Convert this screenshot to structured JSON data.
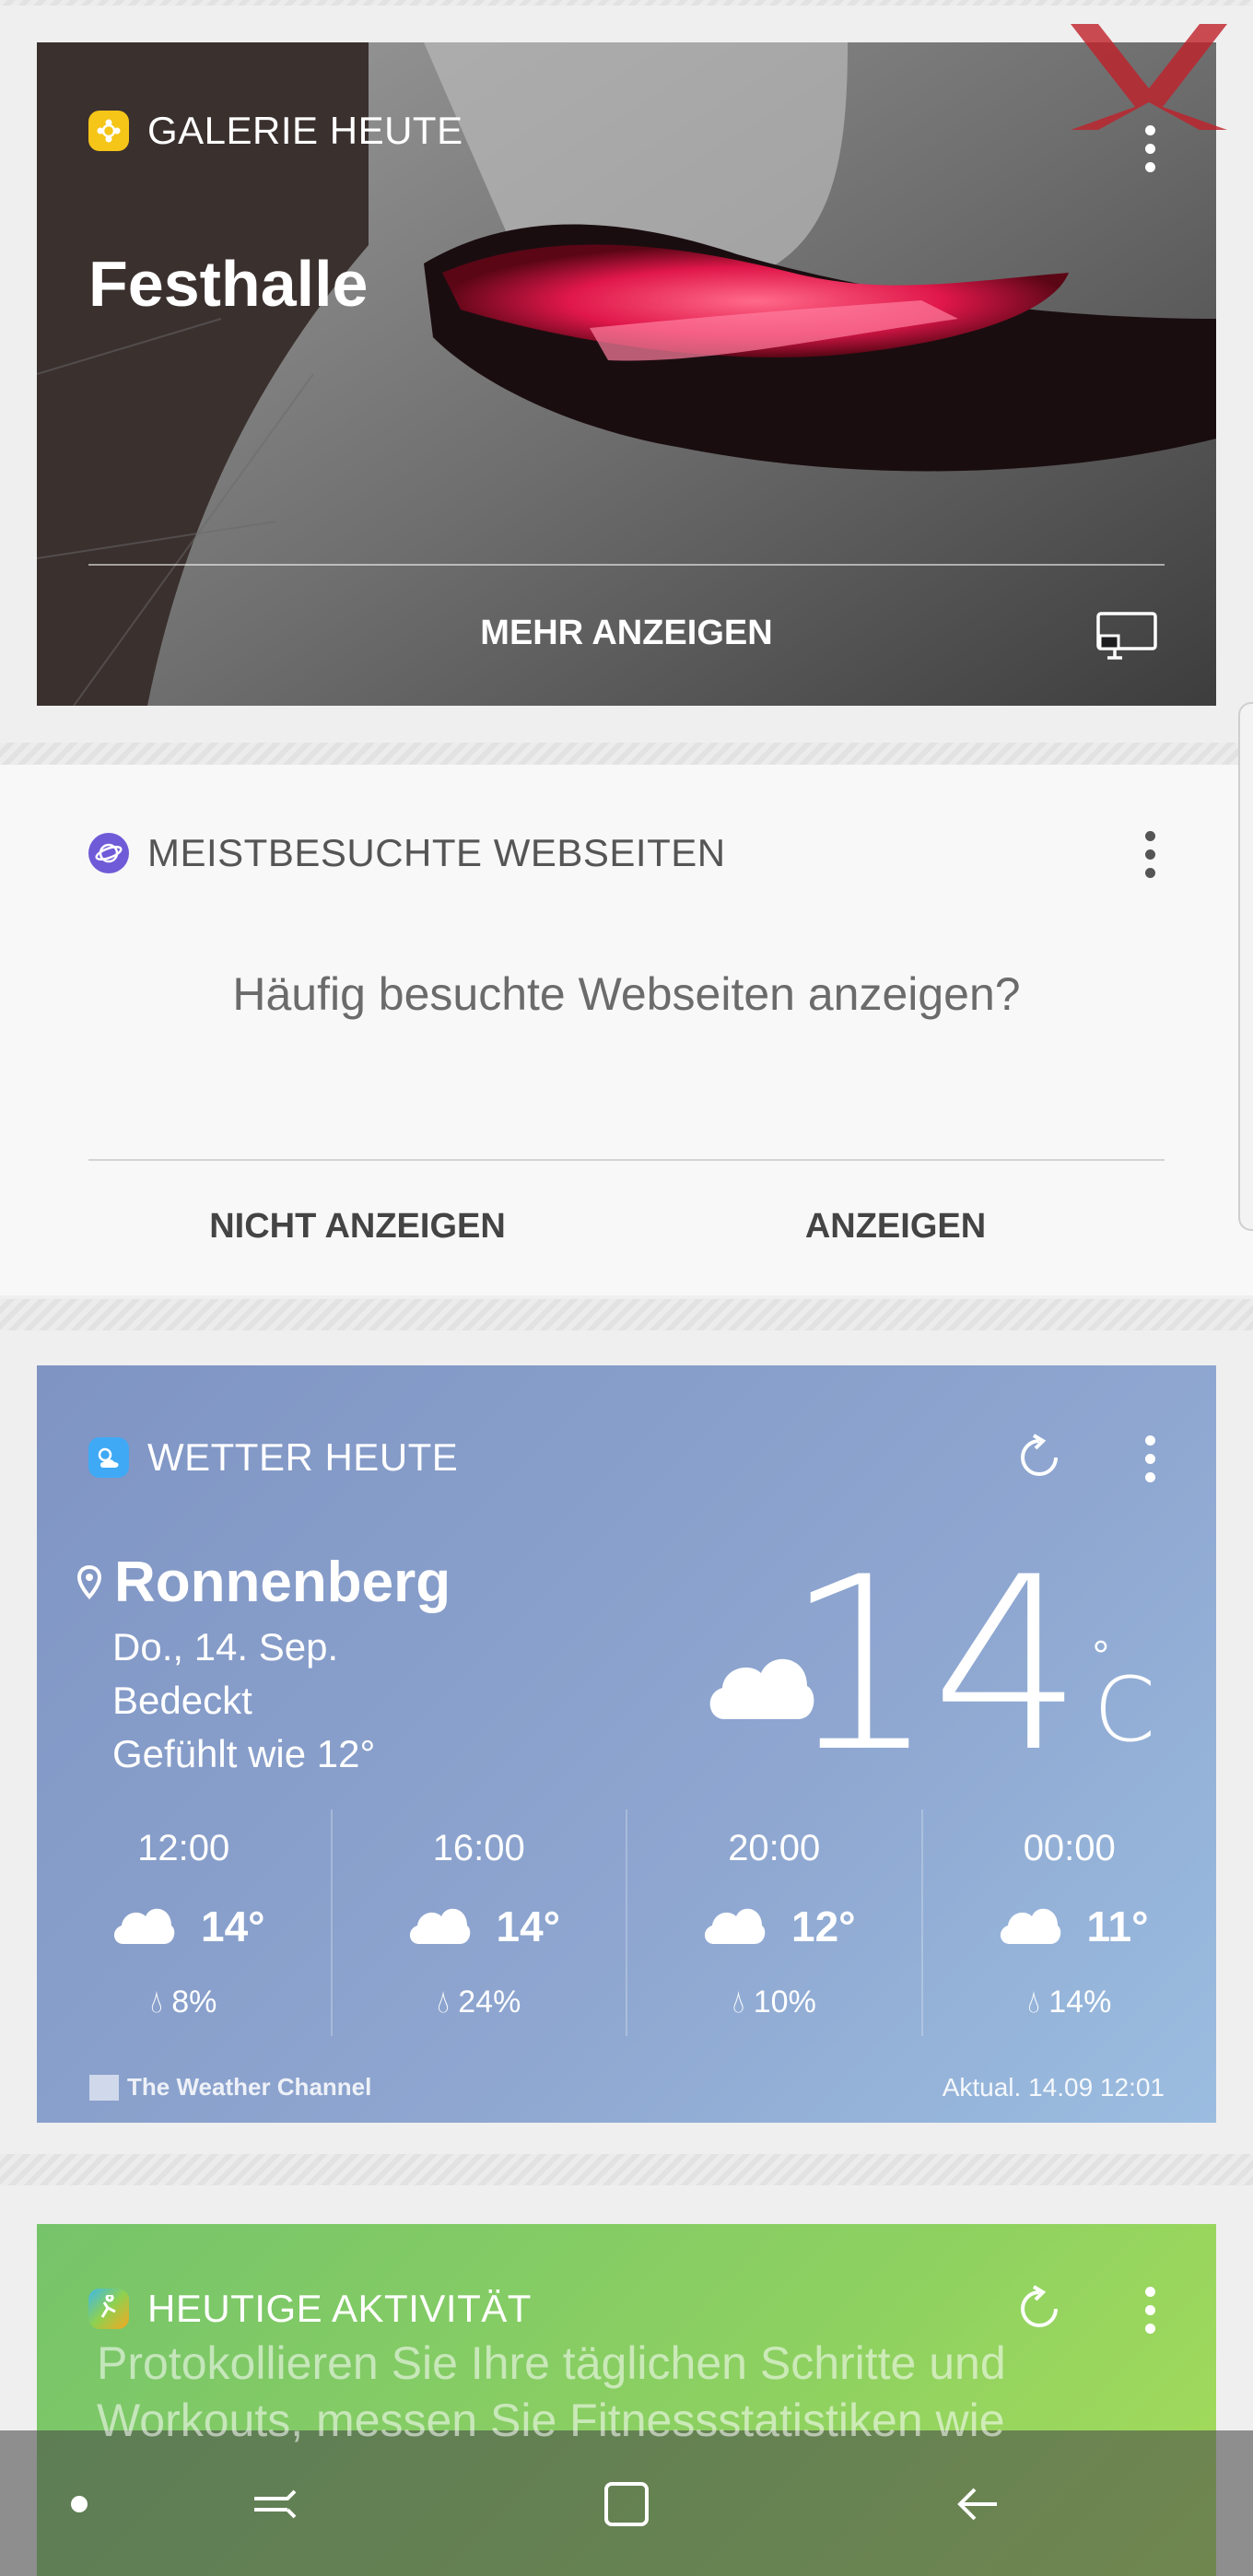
{
  "gallery": {
    "header": "GALERIE HEUTE",
    "title": "Festhalle",
    "more_label": "MEHR ANZEIGEN",
    "icon_color": "#f5c518"
  },
  "web": {
    "header": "MEISTBESUCHTE WEBSEITEN",
    "question": "Häufig besuchte Webseiten anzeigen?",
    "btn_decline": "NICHT ANZEIGEN",
    "btn_accept": "ANZEIGEN",
    "icon_color": "#6f5bd8"
  },
  "weather": {
    "header": "WETTER HEUTE",
    "location": "Ronnenberg",
    "date": "Do., 14. Sep.",
    "condition": "Bedeckt",
    "feels_like": "Gefühlt wie 12°",
    "temp": "14",
    "deg": "°",
    "unit": "C",
    "hours": [
      {
        "time": "12:00",
        "temp": "14°",
        "rain": "8%"
      },
      {
        "time": "16:00",
        "temp": "14°",
        "rain": "24%"
      },
      {
        "time": "20:00",
        "temp": "12°",
        "rain": "10%"
      },
      {
        "time": "00:00",
        "temp": "11°",
        "rain": "14%"
      }
    ],
    "provider": "The Weather Channel",
    "updated": "Aktual. 14.09 12:01"
  },
  "activity": {
    "header": "HEUTIGE AKTIVITÄT",
    "text": "Protokollieren Sie Ihre täglichen Schritte und Workouts, messen Sie Fitnessstatistiken wie"
  }
}
